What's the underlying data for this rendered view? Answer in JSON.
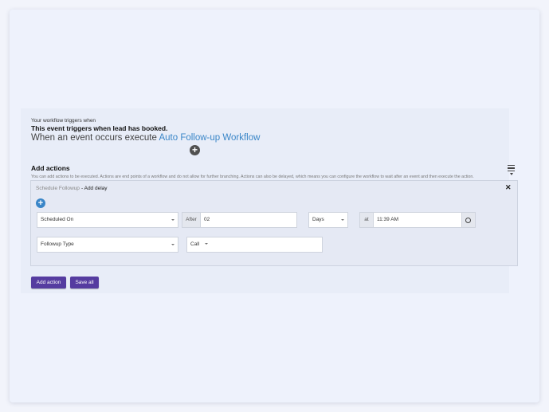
{
  "trigger": {
    "label": "Your workflow triggers when",
    "description": "This event triggers when lead has booked.",
    "heading_prefix": "When an event occurs execute",
    "workflow_name": "Auto Follow-up Workflow"
  },
  "actions": {
    "title": "Add actions",
    "help": "You can add actions to be executed. Actions are end points of a workflow and do not allow for further branching. Actions can also be delayed, which means you can configure the workflow to wait after an event and then execute the action.",
    "card": {
      "type": "Schedule Followup",
      "delay_link": "- Add delay",
      "schedule_select": "Scheduled On",
      "after_label": "After",
      "after_value": "02",
      "unit_select": "Days",
      "at_label": "at",
      "time_value": "11:39 AM",
      "followup_type_select": "Followup Type",
      "method_select": "Call"
    }
  },
  "buttons": {
    "add_action": "Add action",
    "save_all": "Save all"
  },
  "icons": {
    "add_trigger": "plus-circle-dark",
    "add_step": "plus-circle-blue",
    "menu": "hamburger-menu",
    "close": "close-x",
    "clock": "clock"
  },
  "colors": {
    "accent": "#3a86c8",
    "button": "#553ca0"
  }
}
